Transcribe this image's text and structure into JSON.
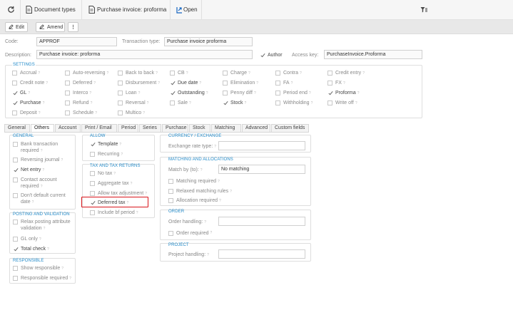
{
  "topbar": {
    "crumb1": "Document types",
    "crumb2": "Purchase invoice: proforma",
    "crumb3": "Open"
  },
  "toolbar": {
    "edit": "Edit",
    "amend": "Amend",
    "more": "⋮"
  },
  "header": {
    "code_label": "Code:",
    "code_value": "APPROF",
    "transaction_type_label": "Transaction type:",
    "transaction_type_value": "Purchase invoice proforma",
    "description_label": "Description:",
    "description_value": "Purchase invoice: proforma",
    "author_label": "Author",
    "access_key_label": "Access key:",
    "access_key_value": "PurchaseInvoice.Proforma"
  },
  "settings": {
    "title": "SETTINGS",
    "items": [
      {
        "label": "Accrual",
        "checked": false
      },
      {
        "label": "Auto-reversing",
        "checked": false
      },
      {
        "label": "Back to back",
        "checked": false
      },
      {
        "label": "CB",
        "checked": false
      },
      {
        "label": "Charge",
        "checked": false
      },
      {
        "label": "Contra",
        "checked": false
      },
      {
        "label": "Credit entry",
        "checked": false
      },
      {
        "label": "Credit note",
        "checked": false
      },
      {
        "label": "Deferred",
        "checked": false
      },
      {
        "label": "Disbursement",
        "checked": false
      },
      {
        "label": "Due date",
        "checked": true
      },
      {
        "label": "Elimination",
        "checked": false
      },
      {
        "label": "FA",
        "checked": false
      },
      {
        "label": "FX",
        "checked": false
      },
      {
        "label": "GL",
        "checked": true
      },
      {
        "label": "Interco",
        "checked": false
      },
      {
        "label": "Loan",
        "checked": false
      },
      {
        "label": "Outstanding",
        "checked": true
      },
      {
        "label": "Penny diff",
        "checked": false
      },
      {
        "label": "Period end",
        "checked": false
      },
      {
        "label": "Proforma",
        "checked": true
      },
      {
        "label": "Purchase",
        "checked": true
      },
      {
        "label": "Refund",
        "checked": false
      },
      {
        "label": "Reversal",
        "checked": false
      },
      {
        "label": "Sale",
        "checked": false
      },
      {
        "label": "Stock",
        "checked": true
      },
      {
        "label": "Withholding",
        "checked": false
      },
      {
        "label": "Write off",
        "checked": false
      },
      {
        "label": "Deposit",
        "checked": false
      },
      {
        "label": "Schedule",
        "checked": false
      },
      {
        "label": "Multico",
        "checked": false
      }
    ]
  },
  "tabs": [
    "General",
    "Others",
    "Account",
    "Print / Email",
    "Period",
    "Series",
    "Purchase",
    "Stock",
    "Matching",
    "Advanced",
    "Custom fields"
  ],
  "general": {
    "title": "GENERAL",
    "items": [
      {
        "label": "Bank transaction required",
        "checked": false
      },
      {
        "label": "Reversing journal",
        "checked": false
      },
      {
        "label": "Net entry",
        "checked": true
      },
      {
        "label": "Contact account required",
        "checked": false
      },
      {
        "label": "Don't default current date",
        "checked": false
      }
    ]
  },
  "posting": {
    "title": "POSTING AND VALIDATION",
    "items": [
      {
        "label": "Relax posting attribute validation",
        "checked": false
      },
      {
        "label": "GL only",
        "checked": false
      },
      {
        "label": "Total check",
        "checked": true
      }
    ]
  },
  "responsible": {
    "title": "RESPONSIBLE",
    "items": [
      {
        "label": "Show responsible",
        "checked": false
      },
      {
        "label": "Responsible required",
        "checked": false
      }
    ]
  },
  "allow": {
    "title": "ALLOW",
    "items": [
      {
        "label": "Template",
        "checked": true
      },
      {
        "label": "Recurring",
        "checked": false
      }
    ]
  },
  "tax": {
    "title": "TAX AND TAX RETURNS",
    "items": [
      {
        "label": "No tax",
        "checked": false
      },
      {
        "label": "Aggregate tax",
        "checked": false
      },
      {
        "label": "Allow tax adjustment",
        "checked": false
      },
      {
        "label": "Deferred tax",
        "checked": true
      },
      {
        "label": "Include bf period",
        "checked": false
      }
    ]
  },
  "currency": {
    "title": "CURRENCY / EXCHANGE",
    "rate_label": "Exchange rate type:",
    "rate_value": ""
  },
  "matching": {
    "title": "MATCHING AND ALLOCATIONS",
    "match_by_label": "Match by (to):",
    "match_by_value": "No matching",
    "items": [
      {
        "label": "Matching required",
        "checked": false
      },
      {
        "label": "Relaxed matching rules",
        "checked": false
      },
      {
        "label": "Allocation required",
        "checked": false
      }
    ]
  },
  "order": {
    "title": "ORDER",
    "handling_label": "Order handling:",
    "handling_value": "",
    "required_label": "Order required"
  },
  "project": {
    "title": "PROJECT",
    "handling_label": "Project handling:",
    "handling_value": ""
  },
  "colors": {
    "accent": "#1e88c8",
    "highlight": "#d9141a",
    "open_icon": "#1565c0"
  }
}
